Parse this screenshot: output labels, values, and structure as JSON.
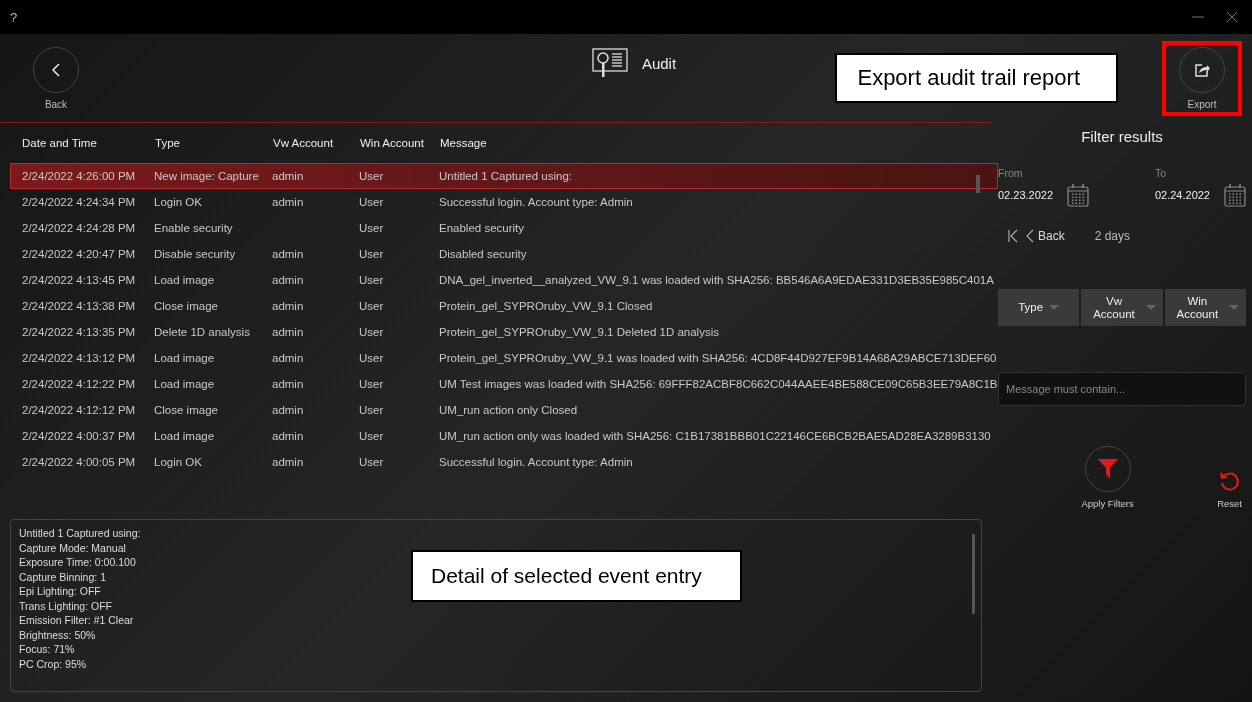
{
  "window": {
    "help": "?"
  },
  "header": {
    "back": "Back",
    "title": "Audit",
    "callout": "Export audit trail report",
    "export": "Export",
    "export_highlighted": true
  },
  "table": {
    "columns": [
      "Date and Time",
      "Type",
      "Vw Account",
      "Win Account",
      "Message"
    ],
    "rows": [
      {
        "date": "2/24/2022 4:26:00 PM",
        "type": "New image: Capture",
        "vw": "admin",
        "win": "User",
        "message": "Untitled 1 Captured using:",
        "selected": true
      },
      {
        "date": "2/24/2022 4:24:34 PM",
        "type": "Login OK",
        "vw": "admin",
        "win": "User",
        "message": "Successful login. Account type: Admin",
        "selected": false
      },
      {
        "date": "2/24/2022 4:24:28 PM",
        "type": "Enable security",
        "win": "User",
        "message": "Enabled security",
        "selected": false
      },
      {
        "date": "2/24/2022 4:20:47 PM",
        "type": "Disable security",
        "vw": "admin",
        "win": "User",
        "message": "Disabled security",
        "selected": false
      },
      {
        "date": "2/24/2022 4:13:45 PM",
        "type": "Load image",
        "vw": "admin",
        "win": "User",
        "message": "DNA_gel_inverted__analyzed_VW_9.1 was loaded with SHA256: BB546A6A9EDAE331D3EB35E985C401A",
        "selected": false
      },
      {
        "date": "2/24/2022 4:13:38 PM",
        "type": "Close image",
        "vw": "admin",
        "win": "User",
        "message": "Protein_gel_SYPROruby_VW_9.1 Closed",
        "selected": false
      },
      {
        "date": "2/24/2022 4:13:35 PM",
        "type": "Delete 1D analysis",
        "vw": "admin",
        "win": "User",
        "message": "Protein_gel_SYPROruby_VW_9.1 Deleted 1D analysis",
        "selected": false
      },
      {
        "date": "2/24/2022 4:13:12 PM",
        "type": "Load image",
        "vw": "admin",
        "win": "User",
        "message": "Protein_gel_SYPROruby_VW_9.1 was loaded with SHA256: 4CD8F44D927EF9B14A68A29ABCE713DEF60",
        "selected": false
      },
      {
        "date": "2/24/2022 4:12:22 PM",
        "type": "Load image",
        "vw": "admin",
        "win": "User",
        "message": "UM Test images was loaded with SHA256: 69FFF82ACBF8C662C044AAEE4BE588CE09C65B3EE79A8C1B",
        "selected": false
      },
      {
        "date": "2/24/2022 4:12:12 PM",
        "type": "Close image",
        "vw": "admin",
        "win": "User",
        "message": "UM_run action only Closed",
        "selected": false
      },
      {
        "date": "2/24/2022 4:00:37 PM",
        "type": "Load image",
        "vw": "admin",
        "win": "User",
        "message": "UM_run action only was loaded with SHA256: C1B17381BBB01C22146CE6BCB2BAE5AD28EA3289B3130",
        "selected": false
      },
      {
        "date": "2/24/2022 4:00:05 PM",
        "type": "Login OK",
        "vw": "admin",
        "win": "User",
        "message": "Successful login. Account type: Admin",
        "selected": false
      }
    ]
  },
  "detail": {
    "lines": [
      "Untitled 1 Captured using:",
      "Capture Mode: Manual",
      "Exposure Time: 0:00.100",
      "Capture Binning: 1",
      "Epi Lighting: OFF",
      "Trans Lighting: OFF",
      "Emission Filter: #1 Clear",
      "Brightness: 50%",
      "Focus: 71%",
      "PC Crop: 95%"
    ],
    "callout": "Detail of selected event entry"
  },
  "filter": {
    "title": "Filter results",
    "from_label": "From",
    "from": "02.23.2022",
    "to_label": "To",
    "to": "02.24.2022",
    "back": "Back",
    "range": "2 days",
    "dropdowns": [
      "Type",
      "Vw Account",
      "Win Account"
    ],
    "placeholder": "Message must contain...",
    "apply": "Apply Filters",
    "reset": "Reset"
  }
}
